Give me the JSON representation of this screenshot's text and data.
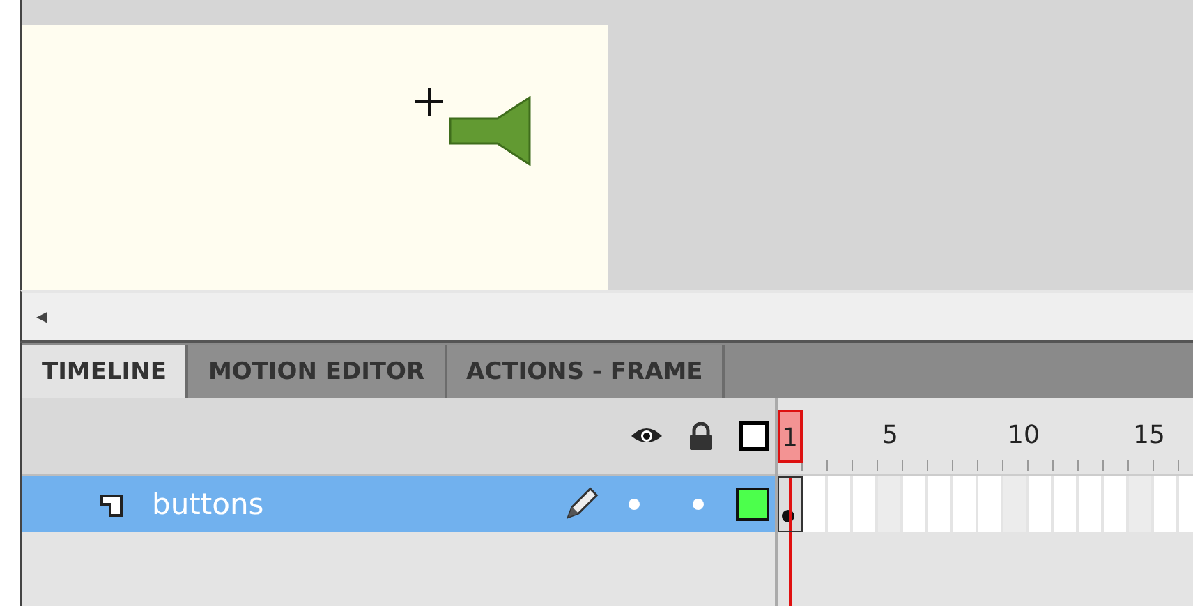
{
  "stage": {
    "nav_arrow": "◂"
  },
  "tabs": [
    {
      "label": "TIMELINE",
      "selected": true
    },
    {
      "label": "MOTION EDITOR",
      "selected": false
    },
    {
      "label": "ACTIONS - FRAME",
      "selected": false
    }
  ],
  "timeline": {
    "ruler_labels": [
      {
        "label": "1",
        "current": true
      },
      {
        "label": "5",
        "current": false
      },
      {
        "label": "10",
        "current": false
      },
      {
        "label": "15",
        "current": false
      }
    ],
    "layers": [
      {
        "name": "buttons",
        "selected": true,
        "editing": true,
        "visible": true,
        "locked": false,
        "color": "#4cff4c",
        "keyframe": true
      }
    ]
  }
}
